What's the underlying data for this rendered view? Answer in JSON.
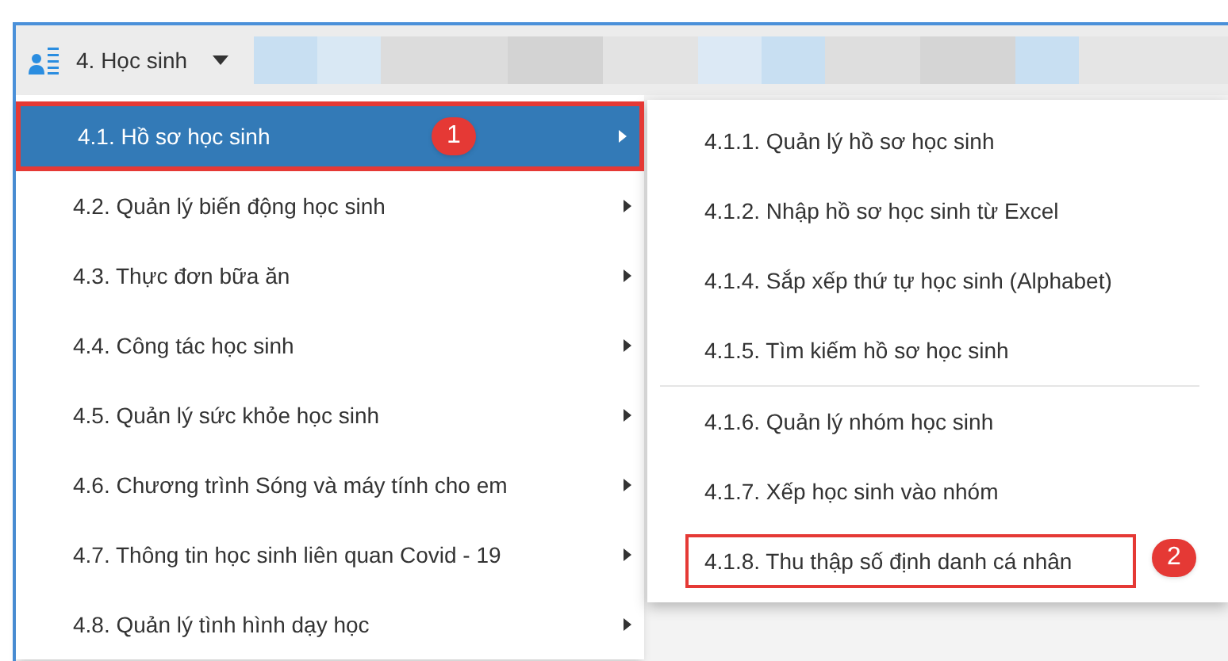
{
  "toolbar": {
    "menu_button": {
      "label": "4. Học sinh",
      "expanded": true
    }
  },
  "menu": {
    "items": [
      {
        "label": "4.1. Hồ sơ học sinh",
        "selected": true,
        "highlighted": true,
        "badge": "1"
      },
      {
        "label": "4.2. Quản lý biến động học sinh",
        "selected": false,
        "highlighted": false
      },
      {
        "label": "4.3. Thực đơn bữa ăn",
        "selected": false,
        "highlighted": false
      },
      {
        "label": "4.4. Công tác học sinh",
        "selected": false,
        "highlighted": false
      },
      {
        "label": "4.5. Quản lý sức khỏe học sinh",
        "selected": false,
        "highlighted": false
      },
      {
        "label": "4.6. Chương trình Sóng và máy tính cho em",
        "selected": false,
        "highlighted": false
      },
      {
        "label": "4.7. Thông tin học sinh liên quan Covid - 19",
        "selected": false,
        "highlighted": false
      },
      {
        "label": "4.8. Quản lý tình hình dạy học",
        "selected": false,
        "highlighted": false
      }
    ]
  },
  "submenu": {
    "groups": [
      [
        {
          "label": "4.1.1. Quản lý hồ sơ học sinh",
          "highlighted": false
        },
        {
          "label": "4.1.2. Nhập hồ sơ học sinh từ Excel",
          "highlighted": false
        },
        {
          "label": "4.1.4. Sắp xếp thứ tự học sinh (Alphabet)",
          "highlighted": false
        },
        {
          "label": "4.1.5. Tìm kiếm hồ sơ học sinh",
          "highlighted": false
        }
      ],
      [
        {
          "label": "4.1.6. Quản lý nhóm học sinh",
          "highlighted": false
        },
        {
          "label": "4.1.7. Xếp học sinh vào nhóm",
          "highlighted": false
        },
        {
          "label": "4.1.8. Thu thập số định danh cá nhân",
          "highlighted": true,
          "badge": "2"
        }
      ]
    ]
  }
}
